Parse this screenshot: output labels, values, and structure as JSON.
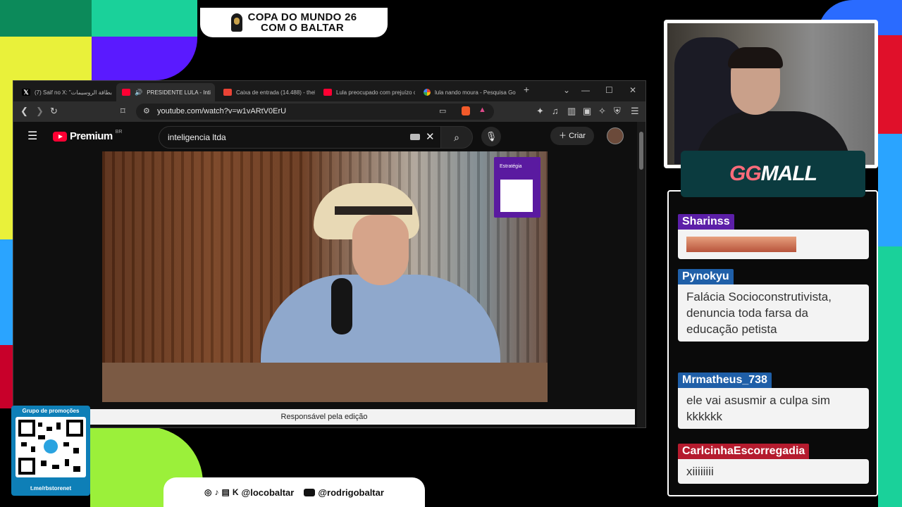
{
  "banner": {
    "title_line1": "COPA DO MUNDO 26",
    "title_line2": "COM O BALTAR"
  },
  "browser": {
    "tabs": [
      {
        "label": "(7) Saif no X: \"بطاقة الروسيمات  ...\"",
        "favicon": "x-icon"
      },
      {
        "label": "PRESIDENTE LULA - Inti",
        "favicon": "youtube-icon",
        "active": true
      },
      {
        "label": "Caixa de entrada (14.488) - theb",
        "favicon": "gmail-icon"
      },
      {
        "label": "Lula preocupado com prejuízo c",
        "favicon": "youtube-icon"
      },
      {
        "label": "lula nando moura - Pesquisa Go",
        "favicon": "google-icon"
      }
    ],
    "new_tab": "+",
    "address": "youtube.com/watch?v=w1vARtV0ErU"
  },
  "youtube": {
    "logo_text": "Premium",
    "logo_sup": "BR",
    "search_query": "inteligencia ltda",
    "create_label": "Criar",
    "sponsor_badge": "Estratégia",
    "caption": "Responsável pela edição"
  },
  "sponsor": {
    "prefix": "GG",
    "suffix": "MALL"
  },
  "chat": {
    "messages": [
      {
        "user": "Sharinss",
        "text": "",
        "color": "#5c1fa8",
        "emotes": 6
      },
      {
        "user": "Pynokyu",
        "text": "Falácia Socioconstrutivista, denuncia toda farsa da educação petista",
        "color": "#1f5fa8"
      },
      {
        "user": "Mrmatheus_738",
        "text": "ele vai asusmir a culpa sim kkkkkk",
        "color": "#1f5fa8"
      },
      {
        "user": "CarlcinhaEscorregadia",
        "text": "xiiiiiiii",
        "color": "#b51b2e"
      }
    ]
  },
  "promo": {
    "label": "Grupo de promoções",
    "link": "t.me/rbstorenet"
  },
  "social": {
    "handle1": "@locobaltar",
    "handle2": "@rodrigobaltar"
  }
}
